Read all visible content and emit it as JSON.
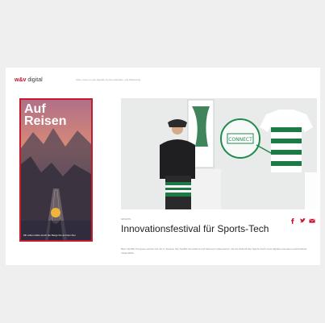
{
  "header": {
    "brand": "w&v",
    "brand_suffix": "digital",
    "tagline": "Alles rund um die digitale Kommunikation und Marketing"
  },
  "ad": {
    "title": "Auf Reisen",
    "caption": "Mit vollem Akku durch die Berge bis an Dein Ziel"
  },
  "hero": {
    "shirt_text": "CONNECT"
  },
  "article": {
    "kicker": "SPORTS",
    "headline": "Innovationsfestival für Sports-Tech",
    "teaser": "Beim SpoBis Kongress werden bei der 2. Session des SpoBis Innovations-Lab Start-ups präsentieren, die die Zukunft des Sports durch neue digitale Lösungen entscheidend mitgestalten."
  },
  "social": [
    {
      "name": "facebook-icon",
      "color": "#c8102e"
    },
    {
      "name": "twitter-icon",
      "color": "#c8102e"
    },
    {
      "name": "mail-icon",
      "color": "#c8102e"
    }
  ]
}
